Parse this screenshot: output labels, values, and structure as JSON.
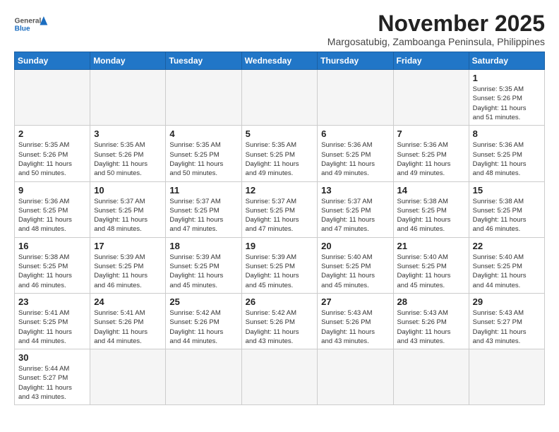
{
  "logo": {
    "general": "General",
    "blue": "Blue"
  },
  "title": "November 2025",
  "subtitle": "Margosatubig, Zamboanga Peninsula, Philippines",
  "headers": [
    "Sunday",
    "Monday",
    "Tuesday",
    "Wednesday",
    "Thursday",
    "Friday",
    "Saturday"
  ],
  "weeks": [
    [
      {
        "day": "",
        "info": "",
        "empty": true
      },
      {
        "day": "",
        "info": "",
        "empty": true
      },
      {
        "day": "",
        "info": "",
        "empty": true
      },
      {
        "day": "",
        "info": "",
        "empty": true
      },
      {
        "day": "",
        "info": "",
        "empty": true
      },
      {
        "day": "",
        "info": "",
        "empty": true
      },
      {
        "day": "1",
        "info": "Sunrise: 5:35 AM\nSunset: 5:26 PM\nDaylight: 11 hours\nand 51 minutes."
      }
    ],
    [
      {
        "day": "2",
        "info": "Sunrise: 5:35 AM\nSunset: 5:26 PM\nDaylight: 11 hours\nand 50 minutes."
      },
      {
        "day": "3",
        "info": "Sunrise: 5:35 AM\nSunset: 5:26 PM\nDaylight: 11 hours\nand 50 minutes."
      },
      {
        "day": "4",
        "info": "Sunrise: 5:35 AM\nSunset: 5:25 PM\nDaylight: 11 hours\nand 50 minutes."
      },
      {
        "day": "5",
        "info": "Sunrise: 5:35 AM\nSunset: 5:25 PM\nDaylight: 11 hours\nand 49 minutes."
      },
      {
        "day": "6",
        "info": "Sunrise: 5:36 AM\nSunset: 5:25 PM\nDaylight: 11 hours\nand 49 minutes."
      },
      {
        "day": "7",
        "info": "Sunrise: 5:36 AM\nSunset: 5:25 PM\nDaylight: 11 hours\nand 49 minutes."
      },
      {
        "day": "8",
        "info": "Sunrise: 5:36 AM\nSunset: 5:25 PM\nDaylight: 11 hours\nand 48 minutes."
      }
    ],
    [
      {
        "day": "9",
        "info": "Sunrise: 5:36 AM\nSunset: 5:25 PM\nDaylight: 11 hours\nand 48 minutes."
      },
      {
        "day": "10",
        "info": "Sunrise: 5:37 AM\nSunset: 5:25 PM\nDaylight: 11 hours\nand 48 minutes."
      },
      {
        "day": "11",
        "info": "Sunrise: 5:37 AM\nSunset: 5:25 PM\nDaylight: 11 hours\nand 47 minutes."
      },
      {
        "day": "12",
        "info": "Sunrise: 5:37 AM\nSunset: 5:25 PM\nDaylight: 11 hours\nand 47 minutes."
      },
      {
        "day": "13",
        "info": "Sunrise: 5:37 AM\nSunset: 5:25 PM\nDaylight: 11 hours\nand 47 minutes."
      },
      {
        "day": "14",
        "info": "Sunrise: 5:38 AM\nSunset: 5:25 PM\nDaylight: 11 hours\nand 46 minutes."
      },
      {
        "day": "15",
        "info": "Sunrise: 5:38 AM\nSunset: 5:25 PM\nDaylight: 11 hours\nand 46 minutes."
      }
    ],
    [
      {
        "day": "16",
        "info": "Sunrise: 5:38 AM\nSunset: 5:25 PM\nDaylight: 11 hours\nand 46 minutes."
      },
      {
        "day": "17",
        "info": "Sunrise: 5:39 AM\nSunset: 5:25 PM\nDaylight: 11 hours\nand 46 minutes."
      },
      {
        "day": "18",
        "info": "Sunrise: 5:39 AM\nSunset: 5:25 PM\nDaylight: 11 hours\nand 45 minutes."
      },
      {
        "day": "19",
        "info": "Sunrise: 5:39 AM\nSunset: 5:25 PM\nDaylight: 11 hours\nand 45 minutes."
      },
      {
        "day": "20",
        "info": "Sunrise: 5:40 AM\nSunset: 5:25 PM\nDaylight: 11 hours\nand 45 minutes."
      },
      {
        "day": "21",
        "info": "Sunrise: 5:40 AM\nSunset: 5:25 PM\nDaylight: 11 hours\nand 45 minutes."
      },
      {
        "day": "22",
        "info": "Sunrise: 5:40 AM\nSunset: 5:25 PM\nDaylight: 11 hours\nand 44 minutes."
      }
    ],
    [
      {
        "day": "23",
        "info": "Sunrise: 5:41 AM\nSunset: 5:25 PM\nDaylight: 11 hours\nand 44 minutes."
      },
      {
        "day": "24",
        "info": "Sunrise: 5:41 AM\nSunset: 5:26 PM\nDaylight: 11 hours\nand 44 minutes."
      },
      {
        "day": "25",
        "info": "Sunrise: 5:42 AM\nSunset: 5:26 PM\nDaylight: 11 hours\nand 44 minutes."
      },
      {
        "day": "26",
        "info": "Sunrise: 5:42 AM\nSunset: 5:26 PM\nDaylight: 11 hours\nand 43 minutes."
      },
      {
        "day": "27",
        "info": "Sunrise: 5:43 AM\nSunset: 5:26 PM\nDaylight: 11 hours\nand 43 minutes."
      },
      {
        "day": "28",
        "info": "Sunrise: 5:43 AM\nSunset: 5:26 PM\nDaylight: 11 hours\nand 43 minutes."
      },
      {
        "day": "29",
        "info": "Sunrise: 5:43 AM\nSunset: 5:27 PM\nDaylight: 11 hours\nand 43 minutes."
      }
    ],
    [
      {
        "day": "30",
        "info": "Sunrise: 5:44 AM\nSunset: 5:27 PM\nDaylight: 11 hours\nand 43 minutes."
      },
      {
        "day": "",
        "info": "",
        "empty": true
      },
      {
        "day": "",
        "info": "",
        "empty": true
      },
      {
        "day": "",
        "info": "",
        "empty": true
      },
      {
        "day": "",
        "info": "",
        "empty": true
      },
      {
        "day": "",
        "info": "",
        "empty": true
      },
      {
        "day": "",
        "info": "",
        "empty": true
      }
    ]
  ]
}
